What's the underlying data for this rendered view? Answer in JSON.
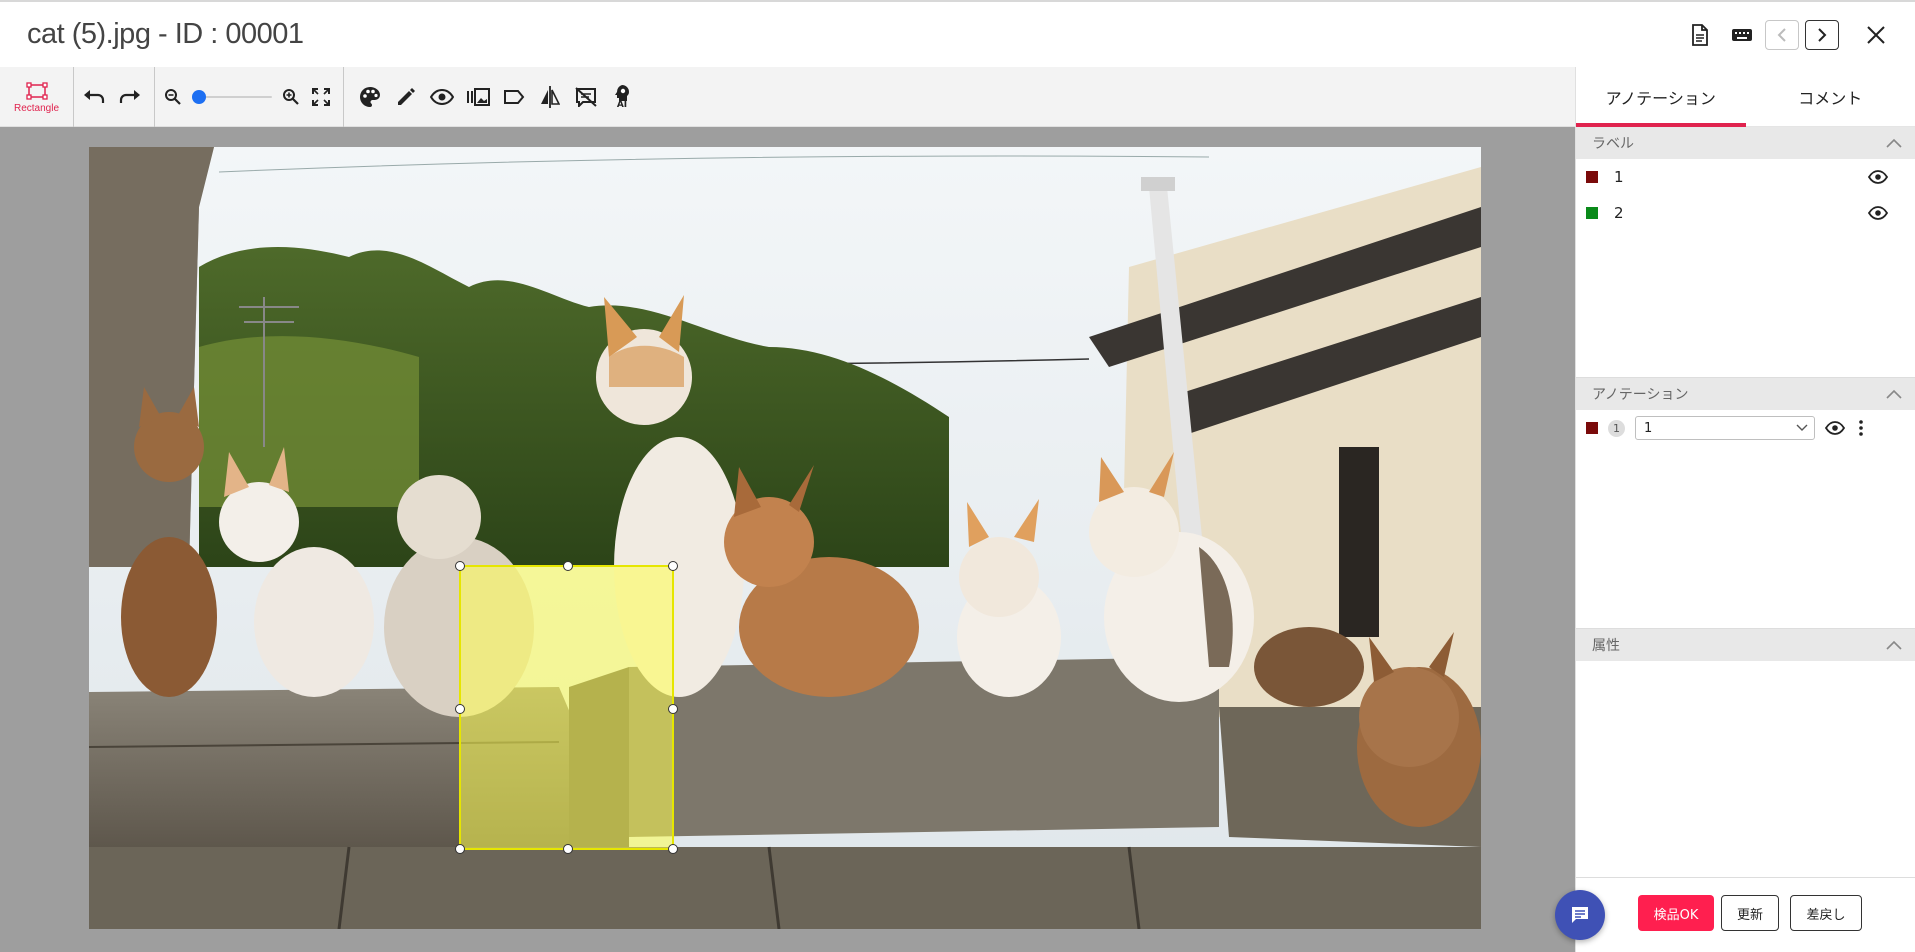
{
  "window": {
    "title": "cat (5).jpg - ID : 00001"
  },
  "toolbar": {
    "rect_tool_label": "Rectangle",
    "ai_label": "AI",
    "zoom_level": 0
  },
  "panel": {
    "tabs": [
      {
        "label": "アノテーション",
        "active": true
      },
      {
        "label": "コメント",
        "active": false
      }
    ],
    "labels_section": {
      "title": "ラベル",
      "items": [
        {
          "name": "1",
          "color": "#7a0a0a"
        },
        {
          "name": "2",
          "color": "#0a8a1a"
        }
      ]
    },
    "annotations_section": {
      "title": "アノテーション",
      "items": [
        {
          "index": "1",
          "color": "#7a0a0a",
          "label": "1"
        }
      ]
    },
    "attributes_section": {
      "title": "属性"
    },
    "footer": {
      "ok_label": "検品OK",
      "update_label": "更新",
      "reject_label": "差戻し"
    }
  },
  "colors": {
    "accent": "#e0234e",
    "ok_button": "#ff1f4f",
    "bbox": "#e6e600",
    "chat_button": "#3f51b5"
  }
}
